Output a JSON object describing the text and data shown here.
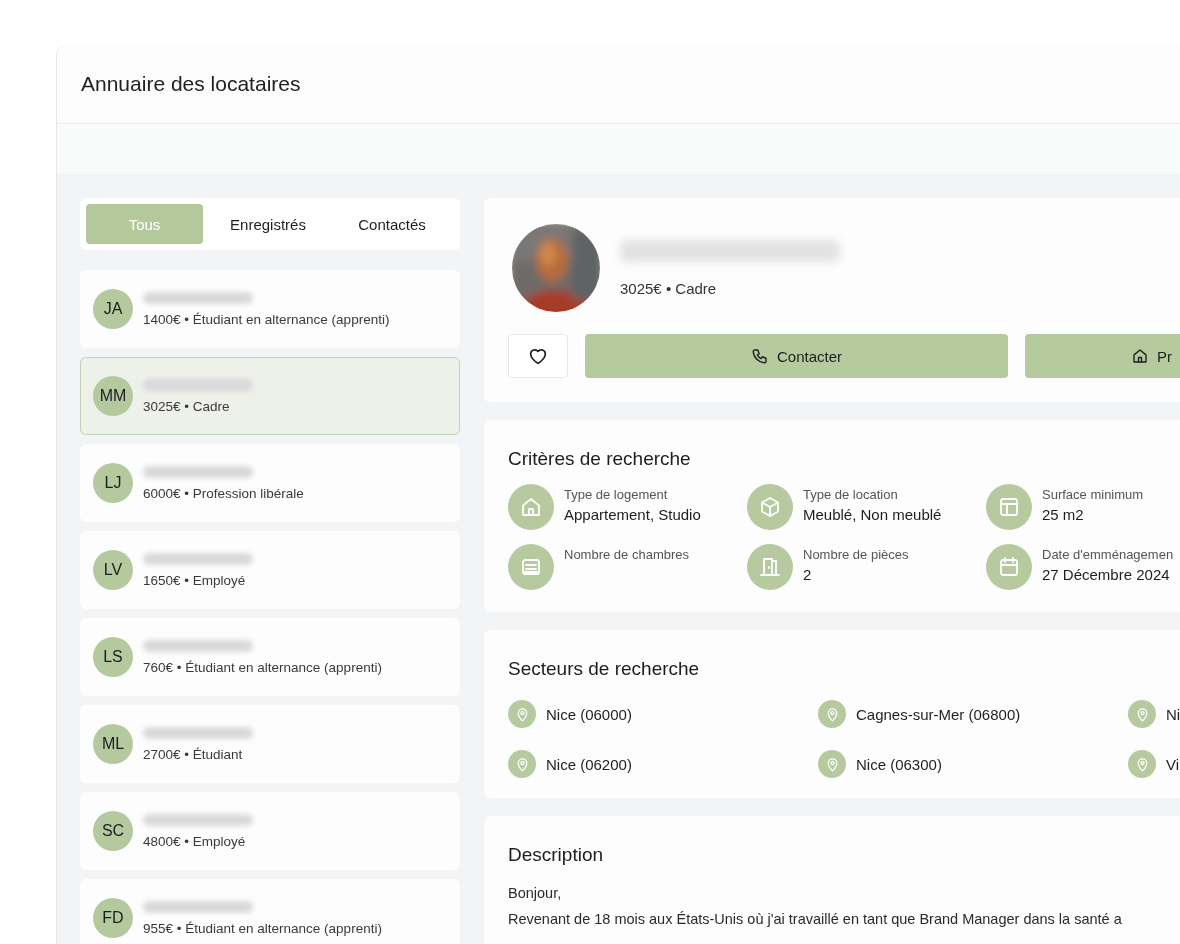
{
  "header": {
    "title": "Annuaire des locataires"
  },
  "tabs": [
    {
      "label": "Tous",
      "selected": true
    },
    {
      "label": "Enregistrés",
      "selected": false
    },
    {
      "label": "Contactés",
      "selected": false
    }
  ],
  "tenants": [
    {
      "initials": "JA",
      "subtitle": "1400€ • Étudiant en alternance (apprenti)",
      "selected": false
    },
    {
      "initials": "MM",
      "subtitle": "3025€ • Cadre",
      "selected": true
    },
    {
      "initials": "LJ",
      "subtitle": "6000€ • Profession libérale",
      "selected": false
    },
    {
      "initials": "LV",
      "subtitle": "1650€ • Employé",
      "selected": false
    },
    {
      "initials": "LS",
      "subtitle": "760€ • Étudiant en alternance (apprenti)",
      "selected": false
    },
    {
      "initials": "ML",
      "subtitle": "2700€ • Étudiant",
      "selected": false
    },
    {
      "initials": "SC",
      "subtitle": "4800€ • Employé",
      "selected": false
    },
    {
      "initials": "FD",
      "subtitle": "955€ • Étudiant en alternance (apprenti)",
      "selected": false
    }
  ],
  "profile": {
    "subtitle": "3025€ • Cadre",
    "favorite": false,
    "buttons": [
      "Contacter",
      "Pr"
    ]
  },
  "criteria": {
    "title": "Critères de recherche",
    "items": [
      {
        "label": "Type de logement",
        "value": "Appartement, Studio"
      },
      {
        "label": "Type de location",
        "value": "Meublé, Non meublé"
      },
      {
        "label": "Surface minimum",
        "value": "25 m2"
      },
      {
        "label": "Nombre de chambres"
      },
      {
        "label": "Nombre de pièces",
        "value": "2"
      },
      {
        "label": "Date d'emménagemen",
        "value": "27 Décembre 2024"
      }
    ]
  },
  "sectors": {
    "title": "Secteurs de recherche",
    "items": [
      "Nice (06000)",
      "Cagnes-sur-Mer (06800)",
      "Ni",
      "Nice (06200)",
      "Nice (06300)",
      "Vi"
    ]
  },
  "description": {
    "title": "Description",
    "lines": [
      "Bonjour,",
      "Revenant de 18 mois aux États-Unis où j'ai travaillé en tant que Brand Manager dans la santé a"
    ]
  }
}
